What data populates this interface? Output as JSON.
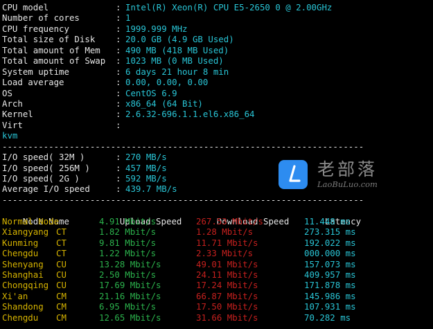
{
  "system_info": [
    {
      "key": "CPU model",
      "value": "Intel(R) Xeon(R) CPU E5-2650 0 @ 2.00GHz"
    },
    {
      "key": "Number of cores",
      "value": "1"
    },
    {
      "key": "CPU frequency",
      "value": "1999.999 MHz"
    },
    {
      "key": "Total size of Disk",
      "value": "20.0 GB (4.9 GB Used)"
    },
    {
      "key": "Total amount of Mem",
      "value": "490 MB (418 MB Used)"
    },
    {
      "key": "Total amount of Swap",
      "value": "1023 MB (0 MB Used)"
    },
    {
      "key": "System uptime",
      "value": "6 days 21 hour 8 min"
    },
    {
      "key": "Load average",
      "value": "0.00, 0.00, 0.00"
    },
    {
      "key": "OS",
      "value": "CentOS 6.9"
    },
    {
      "key": "Arch",
      "value": "x86_64 (64 Bit)"
    },
    {
      "key": "Kernel",
      "value": "2.6.32-696.1.1.el6.x86_64"
    },
    {
      "key": "Virt",
      "value": ""
    }
  ],
  "virt_value": "kvm",
  "separator": "----------------------------------------------------------------------",
  "io_speed": [
    {
      "key": "I/O speed( 32M )",
      "value": "270 MB/s"
    },
    {
      "key": "I/O speed( 256M )",
      "value": "457 MB/s"
    },
    {
      "key": "I/O speed( 2G )",
      "value": "592 MB/s"
    },
    {
      "key": "Average I/O speed",
      "value": "439.7 MB/s"
    }
  ],
  "speed_table": {
    "headers": {
      "node": "Node Name",
      "upload": "Upload Speed",
      "download": "Download Speed",
      "latency": "Latency"
    },
    "rows": [
      {
        "location": "Normal Node",
        "isp": "",
        "upload": "4.91 Mbit/s",
        "download": "267.53 Mbit/s",
        "latency": "11.448 ms"
      },
      {
        "location": "Xiangyang",
        "isp": "CT",
        "upload": "1.82 Mbit/s",
        "download": "1.28 Mbit/s",
        "latency": "273.315 ms"
      },
      {
        "location": "Kunming",
        "isp": "CT",
        "upload": "9.81 Mbit/s",
        "download": "11.71 Mbit/s",
        "latency": "192.022 ms"
      },
      {
        "location": "Chengdu",
        "isp": "CT",
        "upload": "1.22 Mbit/s",
        "download": "2.33 Mbit/s",
        "latency": "000.000 ms"
      },
      {
        "location": "Shenyang",
        "isp": "CU",
        "upload": "13.28 Mbit/s",
        "download": "49.01 Mbit/s",
        "latency": "157.073 ms"
      },
      {
        "location": "Shanghai",
        "isp": "CU",
        "upload": "2.50 Mbit/s",
        "download": "24.11 Mbit/s",
        "latency": "409.957 ms"
      },
      {
        "location": "Chongqing",
        "isp": "CU",
        "upload": "17.69 Mbit/s",
        "download": "17.24 Mbit/s",
        "latency": "171.878 ms"
      },
      {
        "location": "Xi'an",
        "isp": "CM",
        "upload": "21.16 Mbit/s",
        "download": "66.87 Mbit/s",
        "latency": "145.986 ms"
      },
      {
        "location": "Shandong",
        "isp": "CM",
        "upload": "6.95 Mbit/s",
        "download": "17.50 Mbit/s",
        "latency": "107.931 ms"
      },
      {
        "location": "Chengdu",
        "isp": "CM",
        "upload": "12.65 Mbit/s",
        "download": "31.66 Mbit/s",
        "latency": "70.282 ms"
      }
    ]
  },
  "watermark": {
    "title": "老部落",
    "subtitle": "LaoBuLuo.com",
    "logo_glyph": "l"
  },
  "colors": {
    "background": "#000000",
    "key": "#e6e6e6",
    "value": "#29c5d6",
    "node": "#d7b400",
    "upload": "#2bb24c",
    "download": "#c6201e",
    "latency": "#29c5d6"
  }
}
